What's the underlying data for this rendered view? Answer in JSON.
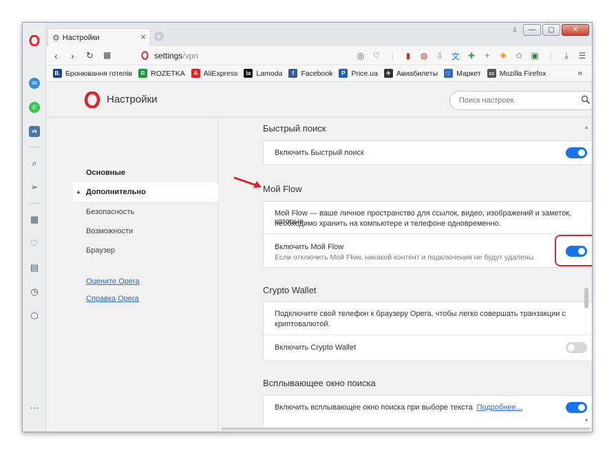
{
  "tab": {
    "title": "Настройки",
    "close": "×",
    "new_tab": "+"
  },
  "window_buttons": {
    "minimize": "—",
    "maximize": "▢",
    "close": "✕",
    "extra": "⇩"
  },
  "address": {
    "url_main": "settings",
    "url_path": "/vpn"
  },
  "bookmarks": [
    {
      "label": "Бронювання готелів",
      "icon": "B.",
      "color": "#17408f"
    },
    {
      "label": "ROZETKA",
      "icon": "R",
      "color": "#1a9a3a"
    },
    {
      "label": "AliExpress",
      "icon": "A",
      "color": "#d9262b"
    },
    {
      "label": "Lamoda",
      "icon": "la",
      "color": "#111111"
    },
    {
      "label": "Facebook",
      "icon": "f",
      "color": "#3b5998"
    },
    {
      "label": "Price.ua",
      "icon": "P",
      "color": "#2a5fb0"
    },
    {
      "label": "Авиабилеты",
      "icon": "✈",
      "color": "#333333"
    },
    {
      "label": "Маркет",
      "icon": "🛒",
      "color": "#2c6bc0"
    },
    {
      "label": "Mozilla Firefox",
      "icon": "▭",
      "color": "#555555"
    }
  ],
  "bookmarks_more": "»",
  "header": {
    "title": "Настройки",
    "search_placeholder": "Поиск настроек"
  },
  "leftnav": {
    "basic": "Основные",
    "advanced": "Дополнительно",
    "security": "Безопасность",
    "features": "Возможности",
    "browser": "Браузер",
    "rate_opera": "Оцените Opera",
    "help_opera": "Справка Opera"
  },
  "sections": {
    "quick_search": {
      "title": "Быстрый поиск",
      "enable_label": "Включить Быстрый поиск",
      "enabled": true
    },
    "my_flow": {
      "title": "Мой Flow",
      "description_line1": "Мой Flow — ваше личное пространство для ссылок, видео, изображений и заметок, которые",
      "description_line2": "необходимо хранить на компьютере и телефоне одновременно.",
      "enable_label": "Включить Мой Flow",
      "enable_sub": "Если отключить Мой Flow, никакой контент и подключения не будут удалены.",
      "enabled": true
    },
    "crypto_wallet": {
      "title": "Crypto Wallet",
      "description_line1": "Подключите свой телефон к браузеру Opera, чтобы легко совершать транзакции с",
      "description_line2": "криптовалютой.",
      "enable_label": "Включить Crypto Wallet",
      "enabled": false
    },
    "search_popup": {
      "title": "Всплывающее окно поиска",
      "enable_label": "Включить всплывающее окно поиска при выборе текста",
      "more_link": "Подробнее...",
      "enabled": true
    }
  },
  "colors": {
    "accent": "#1a73e8",
    "opera_red": "#d9262b",
    "highlight": "#d9262b"
  }
}
